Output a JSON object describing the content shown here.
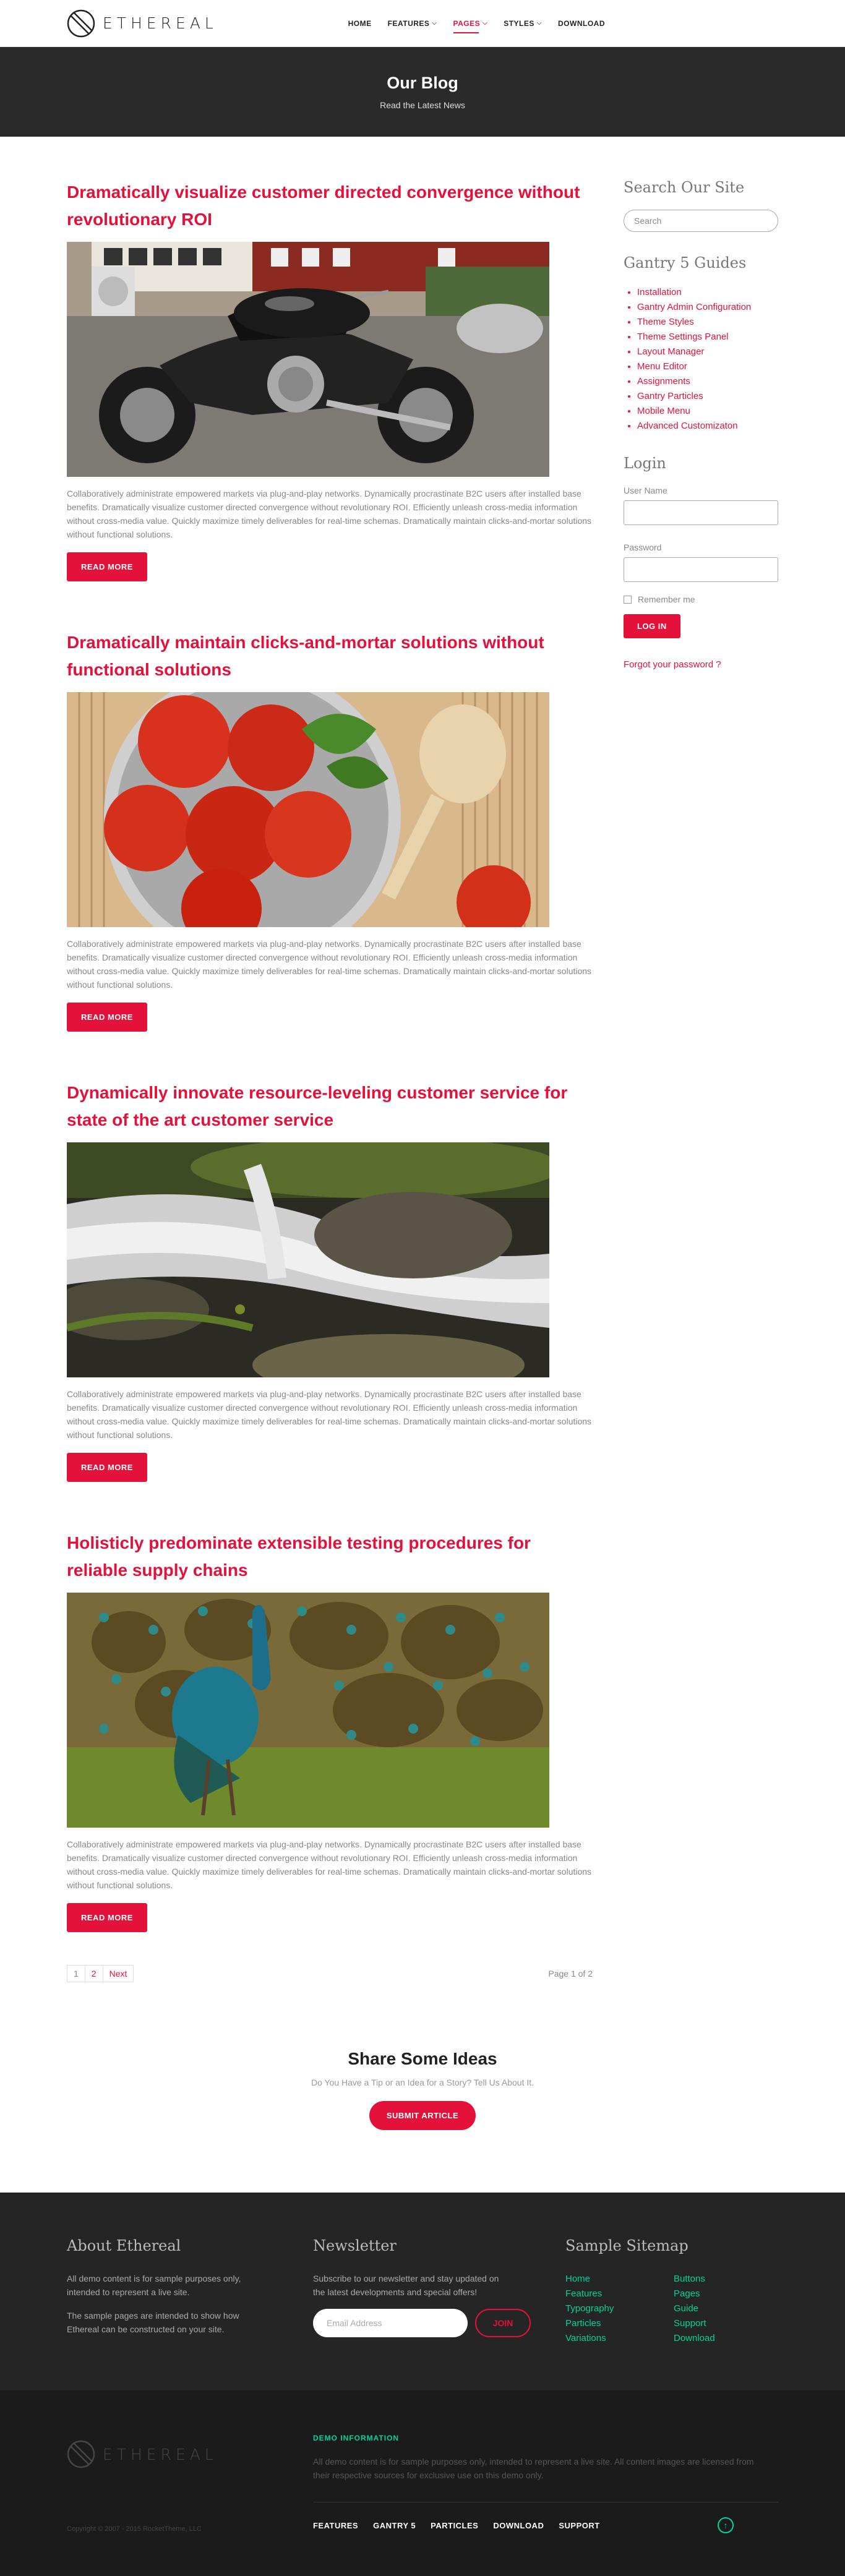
{
  "header": {
    "logo_text": "ETHEREAL",
    "nav": [
      {
        "label": "HOME",
        "dropdown": false,
        "active": false
      },
      {
        "label": "FEATURES",
        "dropdown": true,
        "active": false
      },
      {
        "label": "PAGES",
        "dropdown": true,
        "active": true
      },
      {
        "label": "STYLES",
        "dropdown": true,
        "active": false
      },
      {
        "label": "DOWNLOAD",
        "dropdown": false,
        "active": false
      }
    ]
  },
  "hero": {
    "title": "Our Blog",
    "subtitle": "Read the Latest News"
  },
  "articles": [
    {
      "title": "Dramatically visualize customer directed convergence without revolutionary ROI",
      "image": "motorcycle",
      "excerpt": "Collaboratively administrate empowered markets via plug-and-play networks. Dynamically procrastinate B2C users after installed base benefits. Dramatically visualize customer directed convergence without revolutionary ROI. Efficiently unleash cross-media information without cross-media value. Quickly maximize timely deliverables for real-time schemas. Dramatically maintain clicks-and-mortar solutions without functional solutions.",
      "button": "READ MORE"
    },
    {
      "title": "Dramatically maintain clicks-and-mortar solutions without functional solutions",
      "image": "tomatoes",
      "excerpt": "Collaboratively administrate empowered markets via plug-and-play networks. Dynamically procrastinate B2C users after installed base benefits. Dramatically visualize customer directed convergence without revolutionary ROI. Efficiently unleash cross-media information without cross-media value. Quickly maximize timely deliverables for real-time schemas. Dramatically maintain clicks-and-mortar solutions without functional solutions.",
      "button": "READ MORE"
    },
    {
      "title": "Dynamically innovate resource-leveling customer service for state of the art customer service",
      "image": "waterfall",
      "excerpt": "Collaboratively administrate empowered markets via plug-and-play networks. Dynamically procrastinate B2C users after installed base benefits. Dramatically visualize customer directed convergence without revolutionary ROI. Efficiently unleash cross-media information without cross-media value. Quickly maximize timely deliverables for real-time schemas. Dramatically maintain clicks-and-mortar solutions without functional solutions.",
      "button": "READ MORE"
    },
    {
      "title": "Holisticly predominate extensible testing procedures for reliable supply chains",
      "image": "peacock",
      "excerpt": "Collaboratively administrate empowered markets via plug-and-play networks. Dynamically procrastinate B2C users after installed base benefits. Dramatically visualize customer directed convergence without revolutionary ROI. Efficiently unleash cross-media information without cross-media value. Quickly maximize timely deliverables for real-time schemas. Dramatically maintain clicks-and-mortar solutions without functional solutions.",
      "button": "READ MORE"
    }
  ],
  "pagination": {
    "pages": [
      "1",
      "2"
    ],
    "next": "Next",
    "info": "Page 1 of 2"
  },
  "sidebar": {
    "search_title": "Search Our Site",
    "search_placeholder": "Search",
    "guides_title": "Gantry 5 Guides",
    "guides": [
      "Installation",
      "Gantry Admin Configuration",
      "Theme Styles",
      "Theme Settings Panel",
      "Layout Manager",
      "Menu Editor",
      "Assignments",
      "Gantry Particles",
      "Mobile Menu",
      "Advanced Customizaton"
    ],
    "login_title": "Login",
    "username_label": "User Name",
    "password_label": "Password",
    "remember_label": "Remember me",
    "login_button": "LOG IN",
    "forgot": "Forgot your password ?"
  },
  "share": {
    "title": "Share Some Ideas",
    "subtitle": "Do You Have a Tip or an Idea for a Story? Tell Us About It.",
    "button": "SUBMIT ARTICLE"
  },
  "footer": {
    "about_title": "About Ethereal",
    "about_text1": "All demo content is for sample purposes only, intended to represent a live site.",
    "about_text2": "The sample pages are intended to show how Ethereal can be constructed on your site.",
    "newsletter_title": "Newsletter",
    "newsletter_text": "Subscribe to our newsletter and stay updated on the latest developments and special offers!",
    "email_placeholder": "Email Address",
    "join_button": "JOIN",
    "sitemap_title": "Sample Sitemap",
    "sitemap_col1": [
      "Home",
      "Features",
      "Typography",
      "Particles",
      "Variations"
    ],
    "sitemap_col2": [
      "Buttons",
      "Pages",
      "Guide",
      "Support",
      "Download"
    ]
  },
  "bottom": {
    "logo_text": "ETHEREAL",
    "demo_title": "DEMO INFORMATION",
    "demo_text": "All demo content is for sample purposes only, intended to represent a live site. All content images are licensed from their respective sources for exclusive use on this demo only.",
    "copyright": "Copyright © 2007 - 2015 RocketTheme, LLC",
    "links": [
      "FEATURES",
      "GANTRY 5",
      "PARTICLES",
      "DOWNLOAD",
      "SUPPORT"
    ]
  },
  "colors": {
    "accent": "#e4123b",
    "green": "#00d49b",
    "hero_bg": "#2a2a2a",
    "footer_bg": "#252525",
    "bottom_bg": "#1b1b1b"
  }
}
